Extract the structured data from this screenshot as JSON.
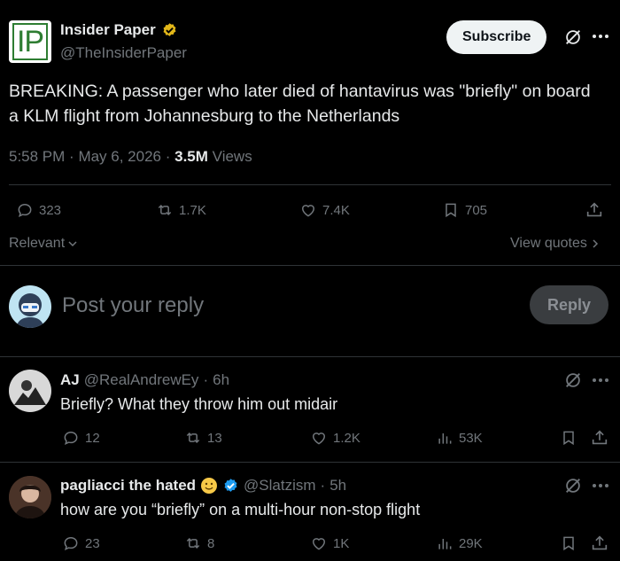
{
  "post": {
    "author_name": "Insider Paper",
    "author_handle": "@TheInsiderPaper",
    "logo_text": "IP",
    "subscribe_label": "Subscribe",
    "text": "BREAKING: A passenger who later died of hantavirus was \"briefly\" on board a KLM flight from Johannesburg to the Netherlands",
    "time": "5:58 PM",
    "date": "May 6, 2026",
    "views_count": "3.5M",
    "views_label": "Views",
    "stats": {
      "replies": "323",
      "reposts": "1.7K",
      "likes": "7.4K",
      "bookmarks": "705"
    }
  },
  "filter": {
    "sort_label": "Relevant",
    "view_quotes_label": "View quotes"
  },
  "composer": {
    "placeholder": "Post your reply",
    "reply_label": "Reply"
  },
  "replies": [
    {
      "name": "AJ",
      "handle": "@RealAndrewEy",
      "time": "6h",
      "text": "Briefly? What they throw him out midair",
      "stats": {
        "replies": "12",
        "reposts": "13",
        "likes": "1.2K",
        "views": "53K"
      }
    },
    {
      "name": "pagliacci the hated",
      "handle": "@Slatzism",
      "time": "5h",
      "text": "how are you “briefly” on a multi-hour non-stop flight",
      "stats": {
        "replies": "23",
        "reposts": "8",
        "likes": "1K",
        "views": "29K"
      }
    }
  ],
  "colors": {
    "background": "#000000",
    "text": "#e7e9ea",
    "muted": "#71767b",
    "verified_gold": "#e2b719",
    "verified_blue": "#1d9bf0",
    "logo_green": "#2e7d32"
  }
}
